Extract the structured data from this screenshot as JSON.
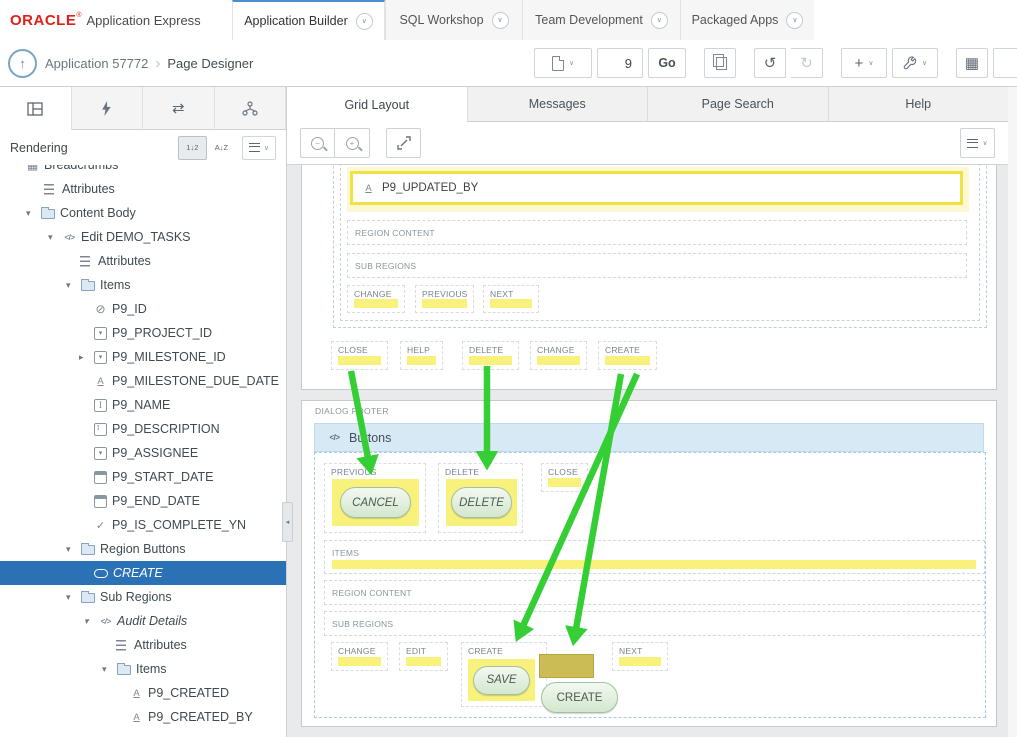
{
  "header": {
    "brand": "ORACLE",
    "reg_mark": "®",
    "product": "Application Express",
    "tabs": [
      {
        "label": "Application Builder"
      },
      {
        "label": "SQL Workshop"
      },
      {
        "label": "Team Development"
      },
      {
        "label": "Packaged Apps"
      }
    ]
  },
  "toolbar": {
    "app_label": "Application 57772",
    "page_title": "Page Designer",
    "page_number": "9",
    "go": "Go"
  },
  "left": {
    "panel_title": "Rendering",
    "tree": [
      {
        "label": "Breadcrumbs"
      },
      {
        "label": "Attributes"
      },
      {
        "label": "Content Body"
      },
      {
        "label": "Edit DEMO_TASKS"
      },
      {
        "label": "Attributes"
      },
      {
        "label": "Items"
      },
      {
        "label": "P9_ID"
      },
      {
        "label": "P9_PROJECT_ID"
      },
      {
        "label": "P9_MILESTONE_ID"
      },
      {
        "label": "P9_MILESTONE_DUE_DATE"
      },
      {
        "label": "P9_NAME"
      },
      {
        "label": "P9_DESCRIPTION"
      },
      {
        "label": "P9_ASSIGNEE"
      },
      {
        "label": "P9_START_DATE"
      },
      {
        "label": "P9_END_DATE"
      },
      {
        "label": "P9_IS_COMPLETE_YN"
      },
      {
        "label": "Region Buttons"
      },
      {
        "label": "CREATE"
      },
      {
        "label": "Sub Regions"
      },
      {
        "label": "Audit Details"
      },
      {
        "label": "Attributes"
      },
      {
        "label": "Items"
      },
      {
        "label": "P9_CREATED"
      },
      {
        "label": "P9_CREATED_BY"
      }
    ]
  },
  "main": {
    "tabs": [
      {
        "label": "Grid Layout"
      },
      {
        "label": "Messages"
      },
      {
        "label": "Page Search"
      },
      {
        "label": "Help"
      }
    ]
  },
  "canvas": {
    "item_name": "P9_UPDATED_BY",
    "region_content": "REGION CONTENT",
    "sub_regions": "SUB REGIONS",
    "row1": [
      "CHANGE",
      "PREVIOUS",
      "NEXT"
    ],
    "row2": [
      "CLOSE",
      "HELP",
      "DELETE",
      "CHANGE",
      "CREATE"
    ],
    "footer": {
      "label": "DIALOG FOOTER",
      "region": "Buttons",
      "slot_previous": "PREVIOUS",
      "slot_delete": "DELETE",
      "slot_close": "CLOSE",
      "btn_cancel": "CANCEL",
      "btn_delete": "DELETE",
      "items": "ITEMS",
      "region_content": "REGION CONTENT",
      "sub_regions": "SUB REGIONS",
      "slot_change": "CHANGE",
      "slot_edit": "EDIT",
      "slot_create": "CREATE",
      "slot_next": "NEXT",
      "btn_save": "SAVE",
      "btn_create": "CREATE"
    }
  },
  "icons": {
    "chevron_down": "∨",
    "breadcrumb_separator": "›",
    "up_arrow": "↑",
    "undo": "↺",
    "redo": "↻",
    "plus": "+",
    "grid": "▦",
    "expand_open": "▾",
    "expand_closed": "▸",
    "collapse_left": "◂",
    "null_item": "⊘",
    "checkbox": "✓",
    "code": "</>",
    "sort_numeric": "1↓2",
    "sort_alpha": "A↓Z",
    "zoom_out": "−",
    "zoom_in": "+"
  },
  "colors": {
    "highlight_yellow": "#F8F17C",
    "item_border_yellow": "#F0E341",
    "arrow_green": "#35CF35",
    "selection_blue": "#2A72B5",
    "region_header_blue": "#D8E9F6",
    "drop_target_olive": "#CBBC55",
    "brand_red": "#E0211A"
  }
}
